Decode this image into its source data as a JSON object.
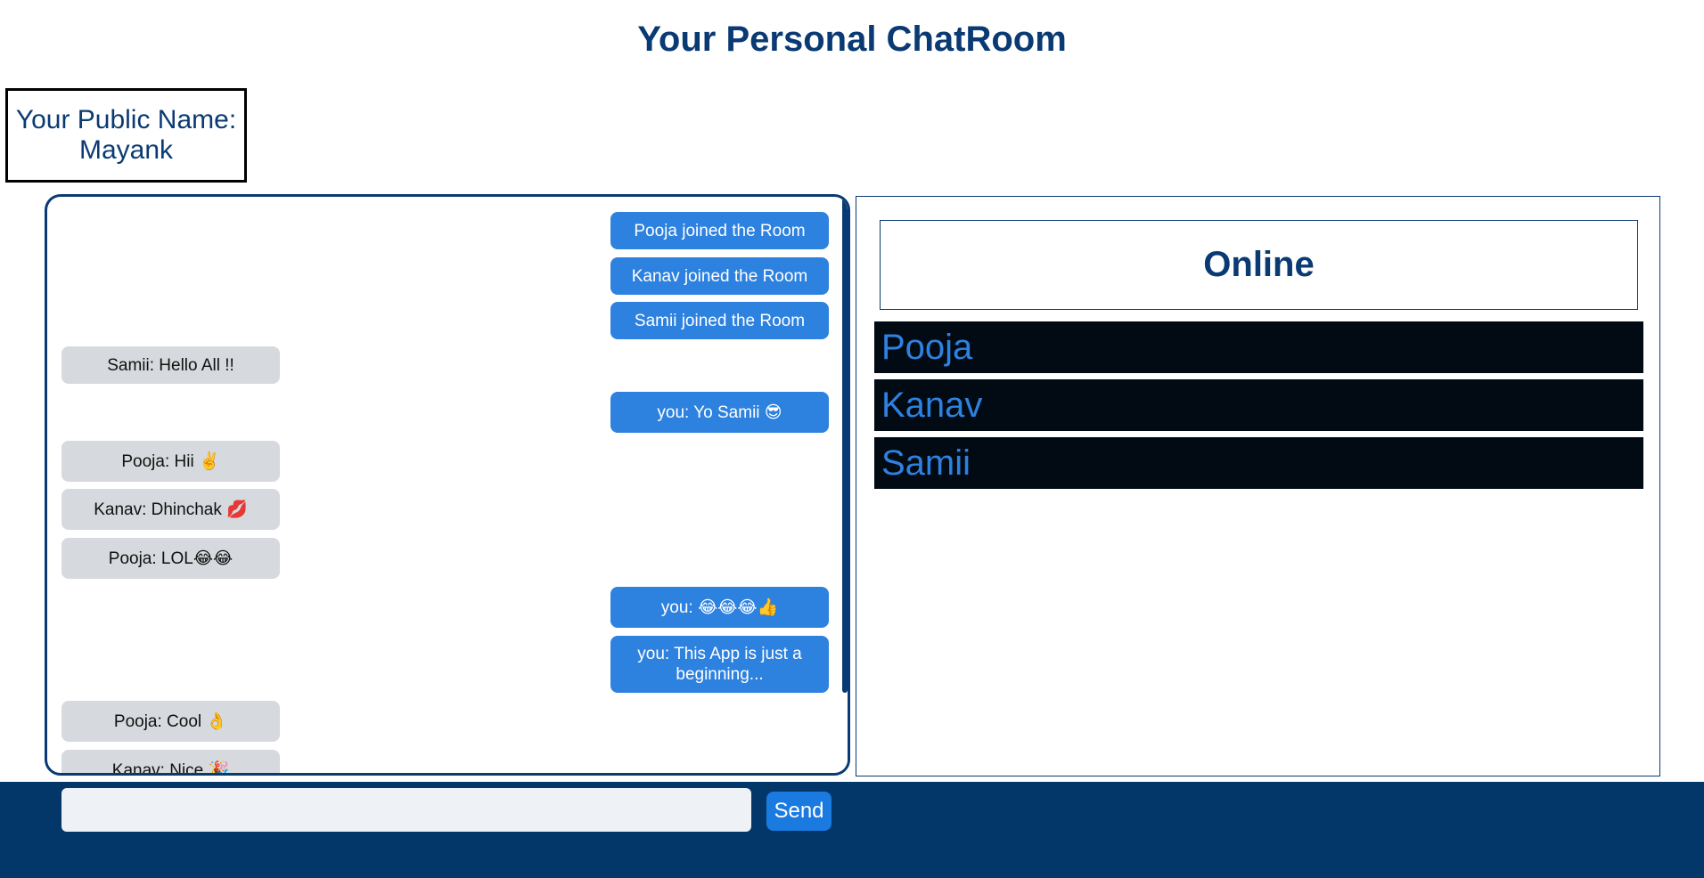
{
  "header": {
    "title": "Your Personal ChatRoom"
  },
  "profile": {
    "label": "Your Public Name:",
    "name": "Mayank"
  },
  "chat": {
    "messages": [
      {
        "side": "right",
        "text": "Pooja joined the Room"
      },
      {
        "side": "right",
        "text": "Kanav joined the Room"
      },
      {
        "side": "right",
        "text": "Samii joined the Room"
      },
      {
        "side": "left",
        "text": "Samii: Hello All !!"
      },
      {
        "side": "right",
        "text": "you: Yo Samii 😎"
      },
      {
        "side": "left",
        "text": "Pooja: Hii ✌️"
      },
      {
        "side": "left",
        "text": "Kanav: Dhinchak 💋"
      },
      {
        "side": "left",
        "text": "Pooja: LOL😂😂"
      },
      {
        "side": "right",
        "text": "you: 😂😂😂👍"
      },
      {
        "side": "right",
        "text": "you: This App is just a beginning..."
      },
      {
        "side": "left",
        "text": "Pooja: Cool 👌"
      },
      {
        "side": "left",
        "text": "Kanav: Nice 🎉"
      }
    ]
  },
  "online": {
    "title": "Online",
    "users": [
      "Pooja",
      "Kanav",
      "Samii"
    ]
  },
  "composer": {
    "input_value": "",
    "placeholder": "",
    "send_label": "Send"
  },
  "colors": {
    "primary": "#0a3a73",
    "bubble_self": "#2d81df",
    "bubble_other": "#d6d9dd",
    "footer": "#03376a",
    "online_row": "#020a14"
  }
}
